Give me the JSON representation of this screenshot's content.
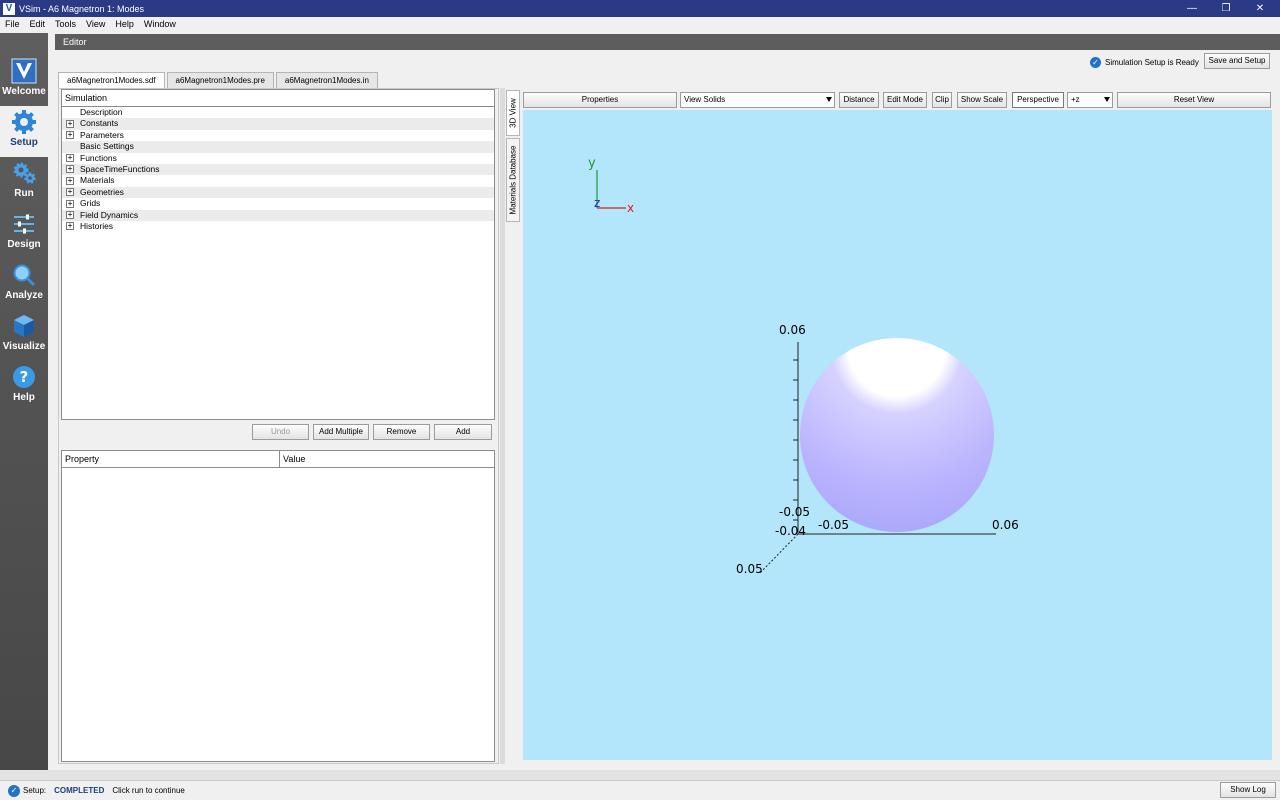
{
  "window": {
    "title": "VSim - A6 Magnetron 1: Modes",
    "icon_letter": "V",
    "minimize": "—",
    "maximize": "❐",
    "close": "✕"
  },
  "menu": [
    "File",
    "Edit",
    "Tools",
    "View",
    "Help",
    "Window"
  ],
  "nav": [
    {
      "label": "Welcome",
      "icon": "vsim-logo-icon"
    },
    {
      "label": "Setup",
      "icon": "gear-icon"
    },
    {
      "label": "Run",
      "icon": "gears-icon"
    },
    {
      "label": "Design",
      "icon": "sliders-icon"
    },
    {
      "label": "Analyze",
      "icon": "magnifier-icon"
    },
    {
      "label": "Visualize",
      "icon": "cube-icon"
    },
    {
      "label": "Help",
      "icon": "question-icon"
    }
  ],
  "editor": {
    "header": "Editor",
    "status_text": "Simulation Setup is Ready",
    "save_button": "Save and Setup",
    "file_tabs": [
      "a6Magnetron1Modes.sdf",
      "a6Magnetron1Modes.pre",
      "a6Magnetron1Modes.in"
    ]
  },
  "tree": {
    "header": "Simulation",
    "items": [
      {
        "label": "Description",
        "expandable": false
      },
      {
        "label": "Constants",
        "expandable": true
      },
      {
        "label": "Parameters",
        "expandable": true
      },
      {
        "label": "Basic Settings",
        "expandable": false
      },
      {
        "label": "Functions",
        "expandable": true
      },
      {
        "label": "SpaceTimeFunctions",
        "expandable": true
      },
      {
        "label": "Materials",
        "expandable": true
      },
      {
        "label": "Geometries",
        "expandable": true
      },
      {
        "label": "Grids",
        "expandable": true
      },
      {
        "label": "Field Dynamics",
        "expandable": true
      },
      {
        "label": "Histories",
        "expandable": true
      }
    ]
  },
  "tree_buttons": {
    "undo": "Undo",
    "add_multiple": "Add Multiple",
    "remove": "Remove",
    "add": "Add"
  },
  "property_table": {
    "col_property": "Property",
    "col_value": "Value"
  },
  "side_tabs": {
    "view3d": "3D View",
    "materials": "Materials Database"
  },
  "view_toolbar": {
    "properties": "Properties",
    "view_select": "View Solids",
    "distance": "Distance",
    "edit_mode": "Edit Mode",
    "clip": "Clip",
    "show_scale": "Show Scale",
    "perspective": "Perspective",
    "axis_select": "+z",
    "reset_view": "Reset View"
  },
  "viewport": {
    "orient_axes": {
      "y": "y",
      "z": "z",
      "x": "x"
    },
    "axis_labels": {
      "y_top": "0.06",
      "y_bottom": "-0.05",
      "x_left": "-0.05",
      "x_right": "0.06",
      "z_near": "-0.04",
      "z_far": "0.05"
    },
    "background_color": "#b3e5fb",
    "sphere_color": "#b0b0ff"
  },
  "statusbar": {
    "label": "Setup:",
    "state": "COMPLETED",
    "hint": "Click run to continue",
    "show_log": "Show Log"
  }
}
